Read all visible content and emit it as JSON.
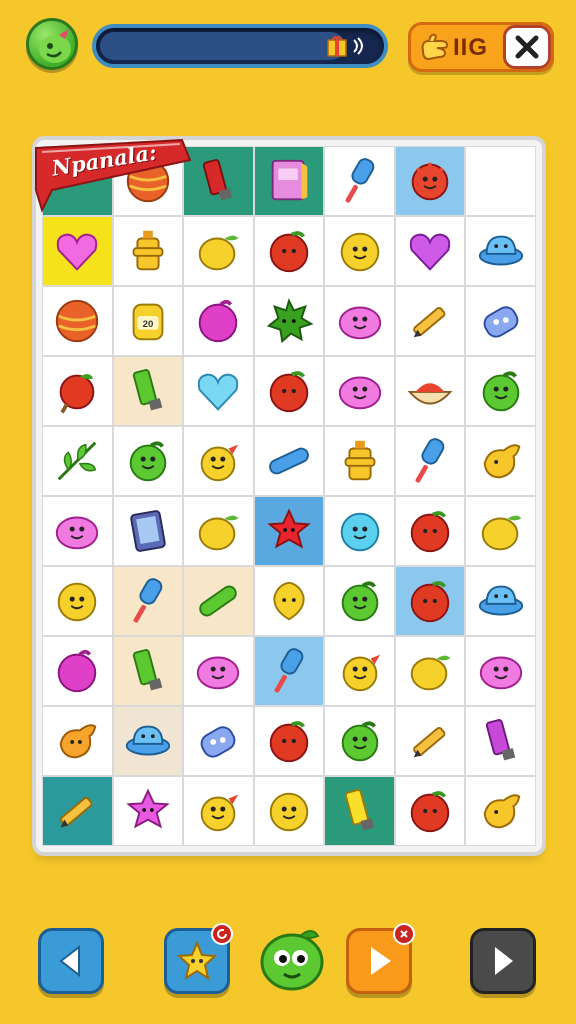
{
  "header": {
    "score_label": "IIG",
    "progress": 0.85
  },
  "board": {
    "banner_title": "Npanala:",
    "columns": 7,
    "rows": 10,
    "cells": [
      [
        "banner",
        "orange-ball-icon",
        "red-marker-icon",
        "pink-notebook-icon",
        "blue-popsicle-icon",
        "red-monster-icon",
        null
      ],
      [
        "pink-heart-icon",
        "yellow-hydrant-icon",
        "yellow-lemon-icon",
        "red-tomato-icon",
        "yellow-smiley-icon",
        "purple-heart-icon",
        "blue-bowl-icon"
      ],
      [
        "orange-ball-icon",
        "honey-jar-icon",
        "magenta-berry-icon",
        "green-splat-icon",
        "pink-blob-icon",
        "pencil-icon",
        "blue-puzzle-icon"
      ],
      [
        "red-apple-icon",
        "green-marker-icon",
        "cyan-heart-icon",
        "red-tomato-icon",
        "pink-blob-icon",
        "soup-bowl-icon",
        "green-apple-icon"
      ],
      [
        "green-leaf-icon",
        "green-apple-icon",
        "yellow-chick-icon",
        "blue-crayon-icon",
        "yellow-hydrant-icon",
        "blue-popsicle-icon",
        "yellow-fish-icon"
      ],
      [
        "pink-blob-icon",
        "tablet-icon",
        "yellow-lemon-icon",
        "red-star-icon",
        "cyan-smiley-icon",
        "red-tomato-icon",
        "yellow-lemon-icon"
      ],
      [
        "yellow-smiley-icon",
        "blue-popsicle-icon",
        "green-crayon-icon",
        "yellow-drop-icon",
        "green-apple-icon",
        "red-tomato-icon",
        "blue-bowl-icon"
      ],
      [
        "magenta-berry-icon",
        "green-marker-icon",
        "pink-blob-icon",
        "blue-popsicle-icon",
        "yellow-chick-icon",
        "yellow-lemon-icon",
        "pink-blob-icon"
      ],
      [
        "orange-fish-icon",
        "blue-bowl-icon",
        "blue-puzzle-icon",
        "red-tomato-icon",
        "green-apple-icon",
        "pencil-icon",
        "purple-marker-icon"
      ],
      [
        "pencil-icon",
        "pink-star-icon",
        "yellow-chick-icon",
        "yellow-smiley-icon",
        "yellow-marker-icon",
        "red-tomato-icon",
        "yellow-fish-icon"
      ]
    ],
    "highlights": [
      {
        "row": 0,
        "col": 2,
        "color": "#2a9a7a"
      },
      {
        "row": 0,
        "col": 3,
        "color": "#2a9a7a"
      },
      {
        "row": 0,
        "col": 5,
        "color": "#8cc8ee"
      },
      {
        "row": 1,
        "col": 0,
        "color": "#f6e21a"
      },
      {
        "row": 3,
        "col": 1,
        "color": "#f7e7c8"
      },
      {
        "row": 5,
        "col": 3,
        "color": "#5aa8e0"
      },
      {
        "row": 6,
        "col": 1,
        "color": "#f7e7c8"
      },
      {
        "row": 6,
        "col": 2,
        "color": "#f7e7c8"
      },
      {
        "row": 6,
        "col": 5,
        "color": "#8cc8ee"
      },
      {
        "row": 7,
        "col": 1,
        "color": "#f7e7c8"
      },
      {
        "row": 7,
        "col": 3,
        "color": "#8cc8ee"
      },
      {
        "row": 8,
        "col": 1,
        "color": "#f0e4d2"
      },
      {
        "row": 9,
        "col": 0,
        "color": "#2a9a9c"
      },
      {
        "row": 9,
        "col": 4,
        "color": "#2a9a7a"
      }
    ]
  },
  "controls": [
    {
      "name": "back-button",
      "icon": "left-arrow-icon",
      "color": "#3b9bd6"
    },
    {
      "name": "shuffle-button",
      "icon": "star-shuffle-icon",
      "color": "#3b9bd6"
    },
    {
      "name": "hint-button",
      "icon": "green-mascot-icon",
      "color": "transparent"
    },
    {
      "name": "play-button",
      "icon": "play-icon",
      "color": "#f99a1b"
    },
    {
      "name": "next-button",
      "icon": "right-arrow-icon",
      "color": "#4a4a4a"
    }
  ],
  "colors": {
    "background": "#f5c72a",
    "banner_red": "#d62a2a"
  }
}
